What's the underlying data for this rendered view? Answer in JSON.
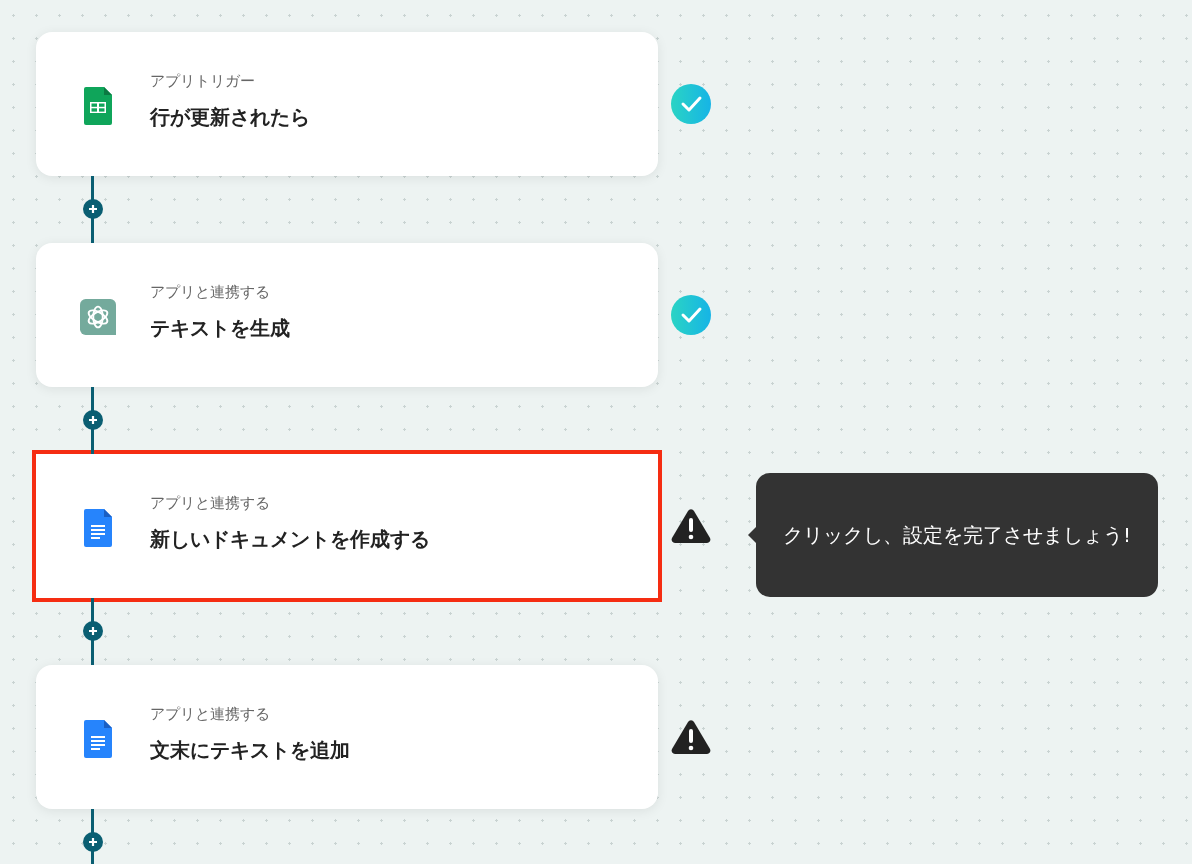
{
  "steps": [
    {
      "kind": "sheets",
      "caption": "アプリトリガー",
      "title": "行が更新されたら",
      "complete": true,
      "selected": false
    },
    {
      "kind": "chatgpt",
      "caption": "アプリと連携する",
      "title": "テキストを生成",
      "complete": true,
      "selected": false
    },
    {
      "kind": "docs",
      "caption": "アプリと連携する",
      "title": "新しいドキュメントを作成する",
      "complete": false,
      "selected": true,
      "tooltip": "クリックし、設定を完了させましょう!"
    },
    {
      "kind": "docs",
      "caption": "アプリと連携する",
      "title": "文末にテキストを追加",
      "complete": false,
      "selected": false
    }
  ]
}
